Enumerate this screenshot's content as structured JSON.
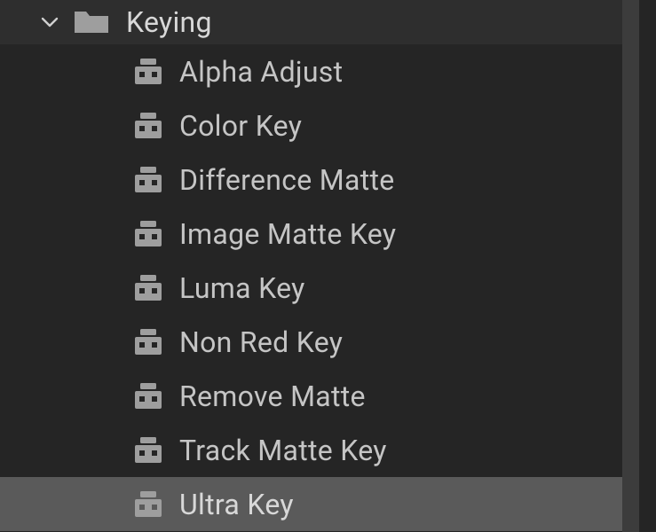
{
  "category": {
    "label": "Keying",
    "expanded": true
  },
  "effects": [
    {
      "label": "Alpha Adjust",
      "selected": false
    },
    {
      "label": "Color Key",
      "selected": false
    },
    {
      "label": "Difference Matte",
      "selected": false
    },
    {
      "label": "Image Matte Key",
      "selected": false
    },
    {
      "label": "Luma Key",
      "selected": false
    },
    {
      "label": "Non Red Key",
      "selected": false
    },
    {
      "label": "Remove Matte",
      "selected": false
    },
    {
      "label": "Track Matte Key",
      "selected": false
    },
    {
      "label": "Ultra Key",
      "selected": true
    }
  ],
  "colors": {
    "bg": "#252525",
    "text": "#c5c5c5",
    "text_bright": "#d8d8d8",
    "selected_bg": "#5a5a5a",
    "icon": "#9e9e9e",
    "scrollbar": "#3c3c3c"
  }
}
